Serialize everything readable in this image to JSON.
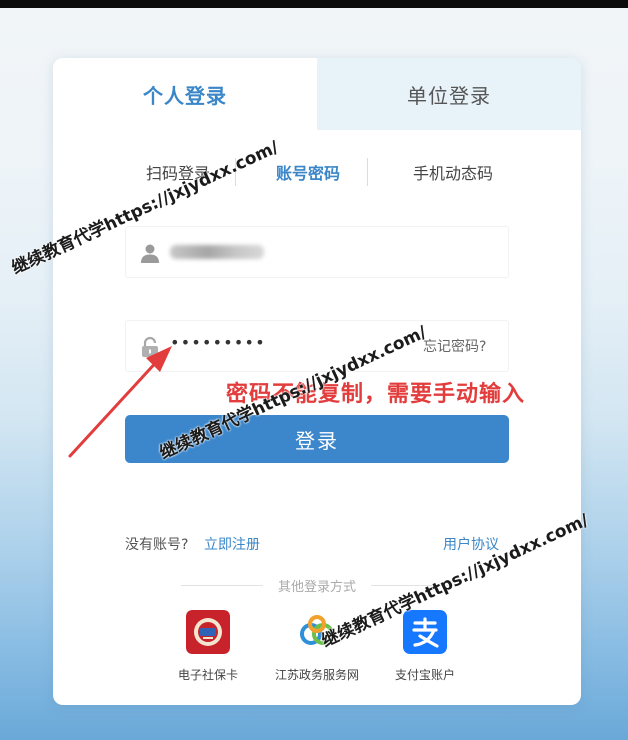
{
  "tabs": {
    "personal_label": "个人登录",
    "unit_label": "单位登录"
  },
  "subtabs": {
    "scan_label": "扫码登录",
    "account_label": "账号密码",
    "phone_label": "手机动态码"
  },
  "form": {
    "password_value": "•••••••••",
    "forgot_label": "忘记密码?",
    "login_label": "登录"
  },
  "footer": {
    "no_account_label": "没有账号?",
    "register_label": "立即注册",
    "agreement_label": "用户协议"
  },
  "other_login": {
    "title": "其他登录方式",
    "options": [
      {
        "label": "电子社保卡",
        "icon": "social-security-card-icon"
      },
      {
        "label": "江苏政务服务网",
        "icon": "jiangsu-gov-service-icon"
      },
      {
        "label": "支付宝账户",
        "icon": "alipay-icon"
      }
    ]
  },
  "annotation": "密码不能复制，需要手动输入",
  "watermark": "继续教育代学https://jxjydxx.com/",
  "colors": {
    "accent": "#3a86c8",
    "button": "#3c87cc",
    "annotation": "#e23c3c"
  }
}
